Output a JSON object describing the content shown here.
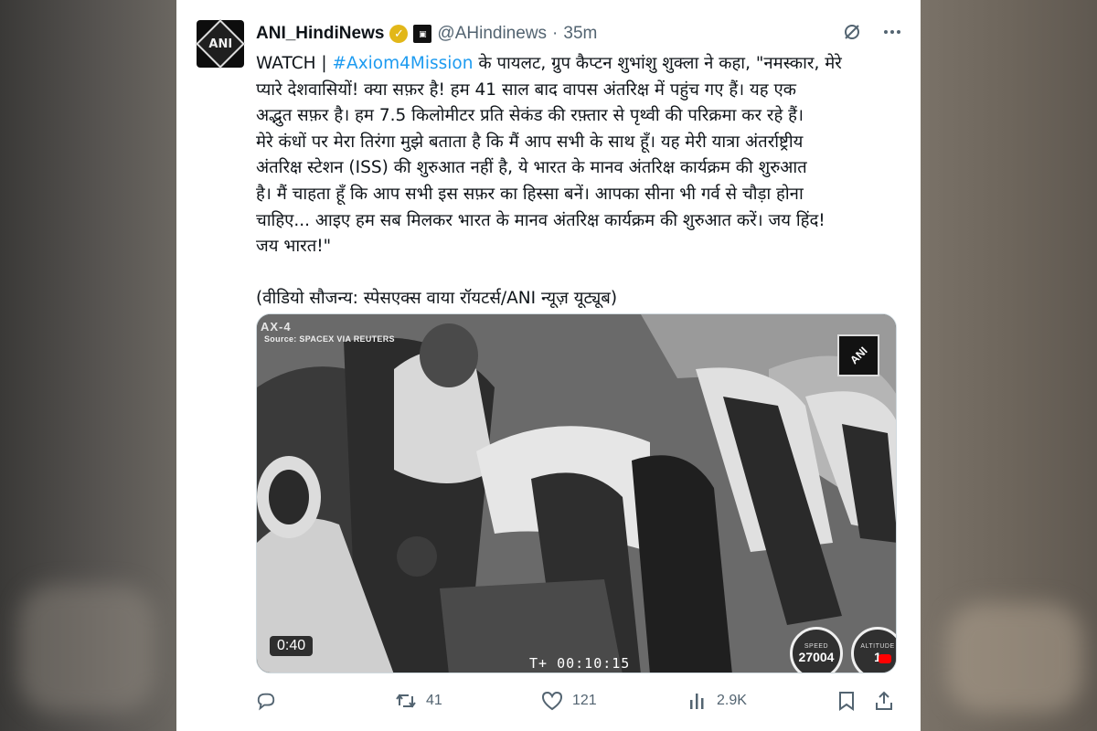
{
  "tweet": {
    "author_name": "ANI_HindiNews",
    "handle": "@AHindinews",
    "separator": "·",
    "time": "35m",
    "text_lines": [
      "के पायलट, ग्रुप कैप्टन शुभांशु शुक्ला ने कहा, \"नमस्कार, मेरे",
      "प्यारे देशवासियों! क्या सफ़र है! हम 41 साल बाद वापस अंतरिक्ष में पहुंच गए हैं। यह एक",
      "अद्भुत सफ़र है। हम 7.5 किलोमीटर प्रति सेकंड की रफ़्तार से पृथ्वी की परिक्रमा कर रहे हैं।",
      "मेरे कंधों पर मेरा तिरंगा मुझे बताता है कि मैं आप सभी के साथ हूँ। यह मेरी यात्रा अंतर्राष्ट्रीय",
      "अंतरिक्ष स्टेशन (ISS) की शुरुआत नहीं है, ये भारत के मानव अंतरिक्ष कार्यक्रम की शुरुआत",
      "है। मैं चाहता हूँ कि आप सभी इस सफ़र का हिस्सा बनें। आपका सीना भी गर्व से चौड़ा होना",
      "चाहिए... आइए हम सब मिलकर भारत के मानव अंतरिक्ष कार्यक्रम की शुरुआत करें। जय हिंद!",
      "जय भारत!\""
    ],
    "text_prefix": "WATCH | ",
    "hashtag": "#Axiom4Mission",
    "credit": "(वीडियो सौजन्य: स्पेसएक्स वाया रॉयटर्स/ANI न्यूज़ यूट्यूब)",
    "avatar_text": "ANI"
  },
  "media": {
    "mission_label": "AX-4",
    "source_label": "Source: SPACEX VIA REUTERS",
    "logo_text": "ANI",
    "duration": "0:40",
    "timer": "T+ 00:10:15",
    "speed_caption": "SPEED",
    "speed_value": "27004",
    "altitude_caption": "ALTITUDE",
    "altitude_value": "1"
  },
  "actions": {
    "replies_count": "",
    "retweets_count": "41",
    "likes_count": "121",
    "views_count": "2.9K"
  },
  "colors": {
    "text": "#0f1419",
    "secondary": "#536471",
    "link": "#1d9bf0",
    "verified_gold": "#e2b719"
  },
  "icons": [
    "grok-icon",
    "more-icon",
    "reply-icon",
    "retweet-icon",
    "like-icon",
    "views-icon",
    "bookmark-icon",
    "share-icon",
    "verified-badge-icon",
    "affiliate-badge-icon"
  ]
}
